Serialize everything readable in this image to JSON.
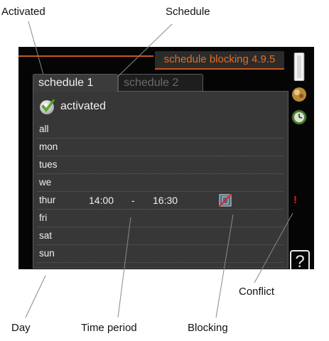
{
  "callouts": {
    "activated": "Activated",
    "schedule": "Schedule",
    "conflict": "Conflict",
    "day": "Day",
    "time_period": "Time period",
    "blocking": "Blocking"
  },
  "screen": {
    "title": "schedule blocking 4.9.5",
    "tabs": [
      {
        "label": "schedule 1",
        "selected": true
      },
      {
        "label": "schedule 2",
        "selected": false
      }
    ],
    "activated_label": "activated",
    "days": [
      {
        "name": "all"
      },
      {
        "name": "mon"
      },
      {
        "name": "tues"
      },
      {
        "name": "we"
      },
      {
        "name": "thur",
        "start": "14:00",
        "separator": "-",
        "end": "16:30"
      },
      {
        "name": "fri"
      },
      {
        "name": "sat"
      },
      {
        "name": "sun"
      }
    ],
    "help_label": "?"
  },
  "colors": {
    "accent_orange": "#e96b1f",
    "screen_bg": "#050505",
    "panel_bg": "#373737",
    "conflict_red": "#e02020"
  }
}
